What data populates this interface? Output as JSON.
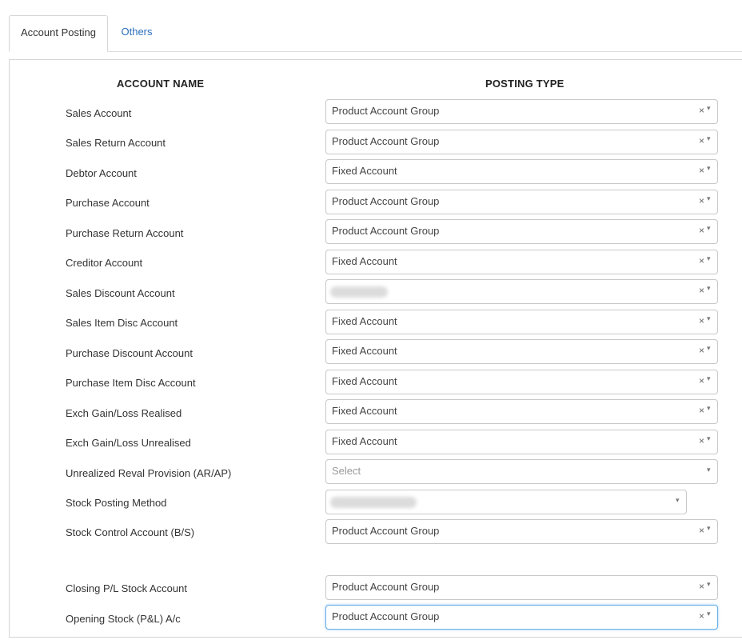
{
  "tabs": [
    {
      "label": "Account Posting",
      "active": true
    },
    {
      "label": "Others",
      "active": false
    }
  ],
  "columns": {
    "account_name": "ACCOUNT NAME",
    "posting_type": "POSTING TYPE"
  },
  "rows": [
    {
      "label": "Sales Account",
      "value": "Product Account Group"
    },
    {
      "label": "Sales Return Account",
      "value": "Product Account Group"
    },
    {
      "label": "Debtor Account",
      "value": "Fixed Account"
    },
    {
      "label": "Purchase Account",
      "value": "Product Account Group"
    },
    {
      "label": "Purchase Return Account",
      "value": "Product Account Group"
    },
    {
      "label": "Creditor Account",
      "value": "Fixed Account"
    },
    {
      "label": "Sales Discount Account",
      "value": ""
    },
    {
      "label": "Sales Item Disc Account",
      "value": "Fixed Account"
    },
    {
      "label": "Purchase Discount Account",
      "value": "Fixed Account"
    },
    {
      "label": "Purchase Item Disc Account",
      "value": "Fixed Account"
    },
    {
      "label": "Exch Gain/Loss Realised",
      "value": "Fixed Account"
    },
    {
      "label": "Exch Gain/Loss Unrealised",
      "value": "Fixed Account"
    },
    {
      "label": "Unrealized Reval Provision (AR/AP)",
      "placeholder": "Select"
    },
    {
      "label": "Stock Posting Method",
      "value": ""
    },
    {
      "label": "Stock Control Account (B/S)",
      "value": "Product Account Group"
    },
    {
      "label": "Closing P/L Stock Account",
      "value": "Product Account Group"
    },
    {
      "label": "Opening Stock (P&L) A/c",
      "value": "Product Account Group"
    }
  ],
  "icons": {
    "clear": "clear-x-icon",
    "caret": "caret-down-icon"
  },
  "colors": {
    "tab_link": "#2a6ebb",
    "focus_border": "#66afe9"
  }
}
